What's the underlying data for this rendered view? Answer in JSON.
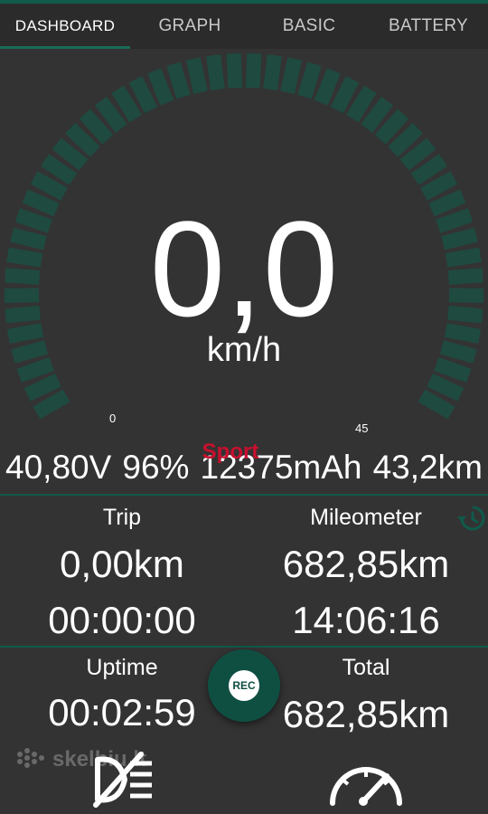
{
  "tabs": [
    {
      "label": "DASHBOARD"
    },
    {
      "label": "GRAPH"
    },
    {
      "label": "BASIC"
    },
    {
      "label": "BATTERY"
    }
  ],
  "gauge": {
    "speed": "0,0",
    "unit": "km/h",
    "scale_min": "0",
    "scale_max": "45",
    "mode": "Sport",
    "level": 0
  },
  "stats": {
    "voltage": "40,80V",
    "battery_percent": "96%",
    "capacity": "12375mAh",
    "range": "43,2km"
  },
  "trip": {
    "label": "Trip",
    "distance": "0,00km",
    "time": "00:00:00"
  },
  "mileometer": {
    "label": "Mileometer",
    "distance": "682,85km",
    "time": "14:06:16"
  },
  "uptime": {
    "label": "Uptime",
    "time": "00:02:59"
  },
  "total": {
    "label": "Total",
    "distance": "682,85km"
  },
  "rec_button": {
    "label": "REC"
  },
  "watermark": {
    "text": "skelbiu.lt"
  },
  "icons": {
    "history": "history-icon",
    "light": "light-off-icon",
    "speedometer": "speedometer-icon"
  },
  "colors": {
    "background": "#333333",
    "accent": "#0f5a4a",
    "gauge_ticks": "#1f4a40",
    "mode": "#c8102e"
  }
}
